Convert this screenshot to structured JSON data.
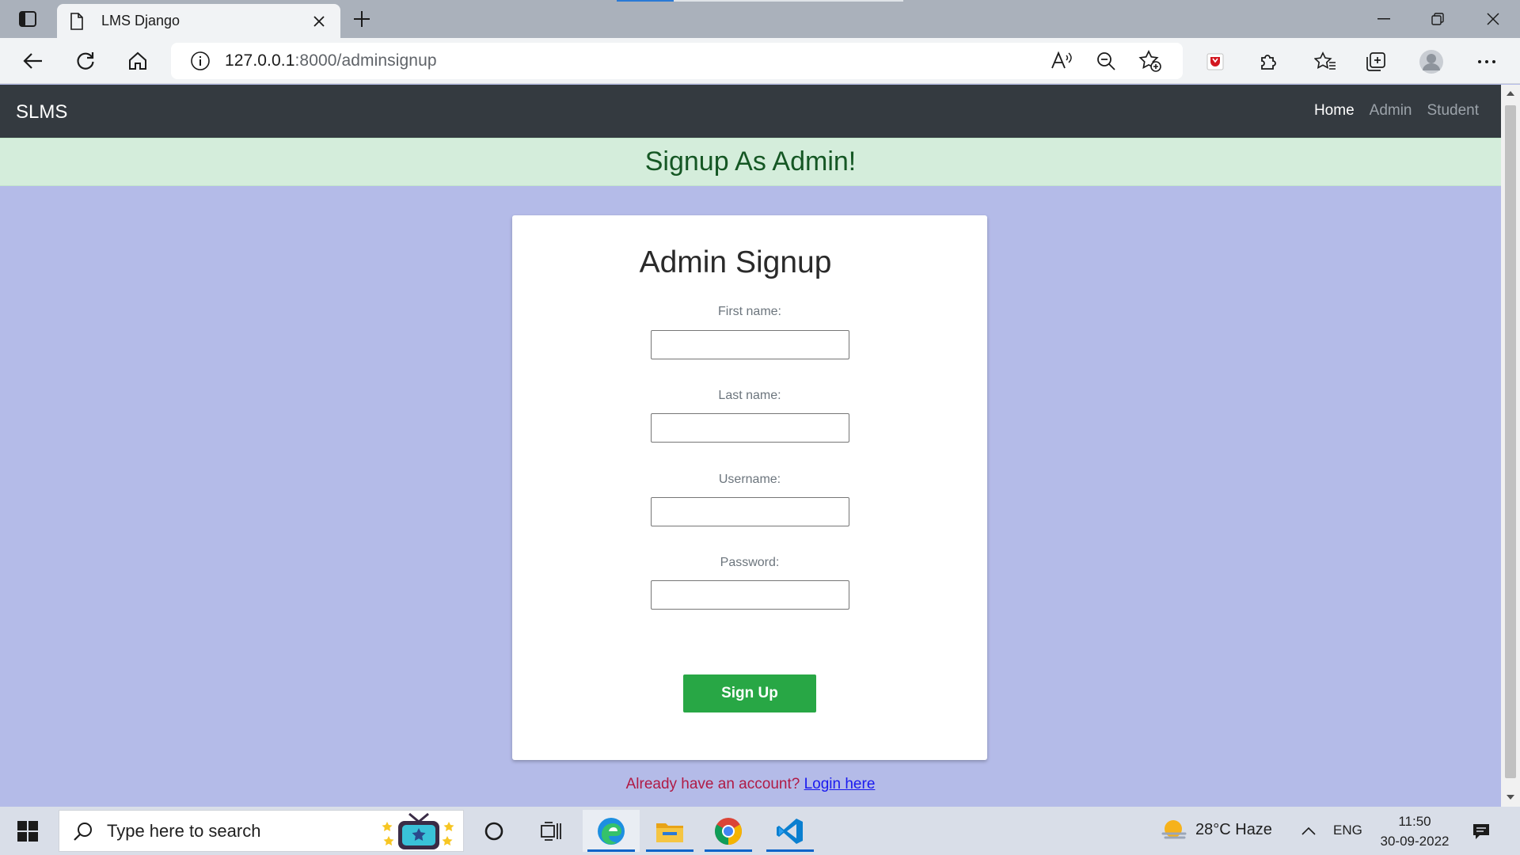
{
  "browser": {
    "tab_title": "LMS Django",
    "url_host": "127.0.0.1",
    "url_rest": ":8000/adminsignup"
  },
  "navbar": {
    "brand": "SLMS",
    "links": [
      {
        "label": "Home",
        "active": true
      },
      {
        "label": "Admin",
        "active": false
      },
      {
        "label": "Student",
        "active": false
      }
    ]
  },
  "alert": {
    "message": "Signup As Admin!"
  },
  "form": {
    "heading": "Admin Signup",
    "fields": [
      {
        "label": "First name:",
        "value": ""
      },
      {
        "label": "Last name:",
        "value": ""
      },
      {
        "label": "Username:",
        "value": ""
      },
      {
        "label": "Password:",
        "value": ""
      }
    ],
    "submit_label": "Sign Up"
  },
  "login_prompt": {
    "text": "Already have an account?",
    "link": "Login here"
  },
  "taskbar": {
    "search_placeholder": "Type here to search",
    "weather": "28°C  Haze",
    "language": "ENG",
    "time": "11:50",
    "date": "30-09-2022"
  },
  "colors": {
    "page_bg": "#b4bbe8",
    "navbar_bg": "#343a40",
    "alert_bg": "#d4eddb",
    "alert_text": "#155724",
    "button_green": "#28a745",
    "login_text": "#b01a45",
    "link_blue": "#1a1aef"
  },
  "icons": {
    "tab_actions": "tab-actions-icon",
    "favicon": "page-icon",
    "back": "back-arrow-icon",
    "refresh": "refresh-icon",
    "home": "home-icon",
    "site_info": "info-icon",
    "read_aloud": "read-aloud-icon",
    "zoom_out": "zoom-out-icon",
    "add_favorite": "add-favorite-icon",
    "extensions": "puzzle-icon",
    "favorites": "favorites-icon",
    "collections": "collections-icon",
    "profile": "profile-icon",
    "more": "more-icon"
  }
}
